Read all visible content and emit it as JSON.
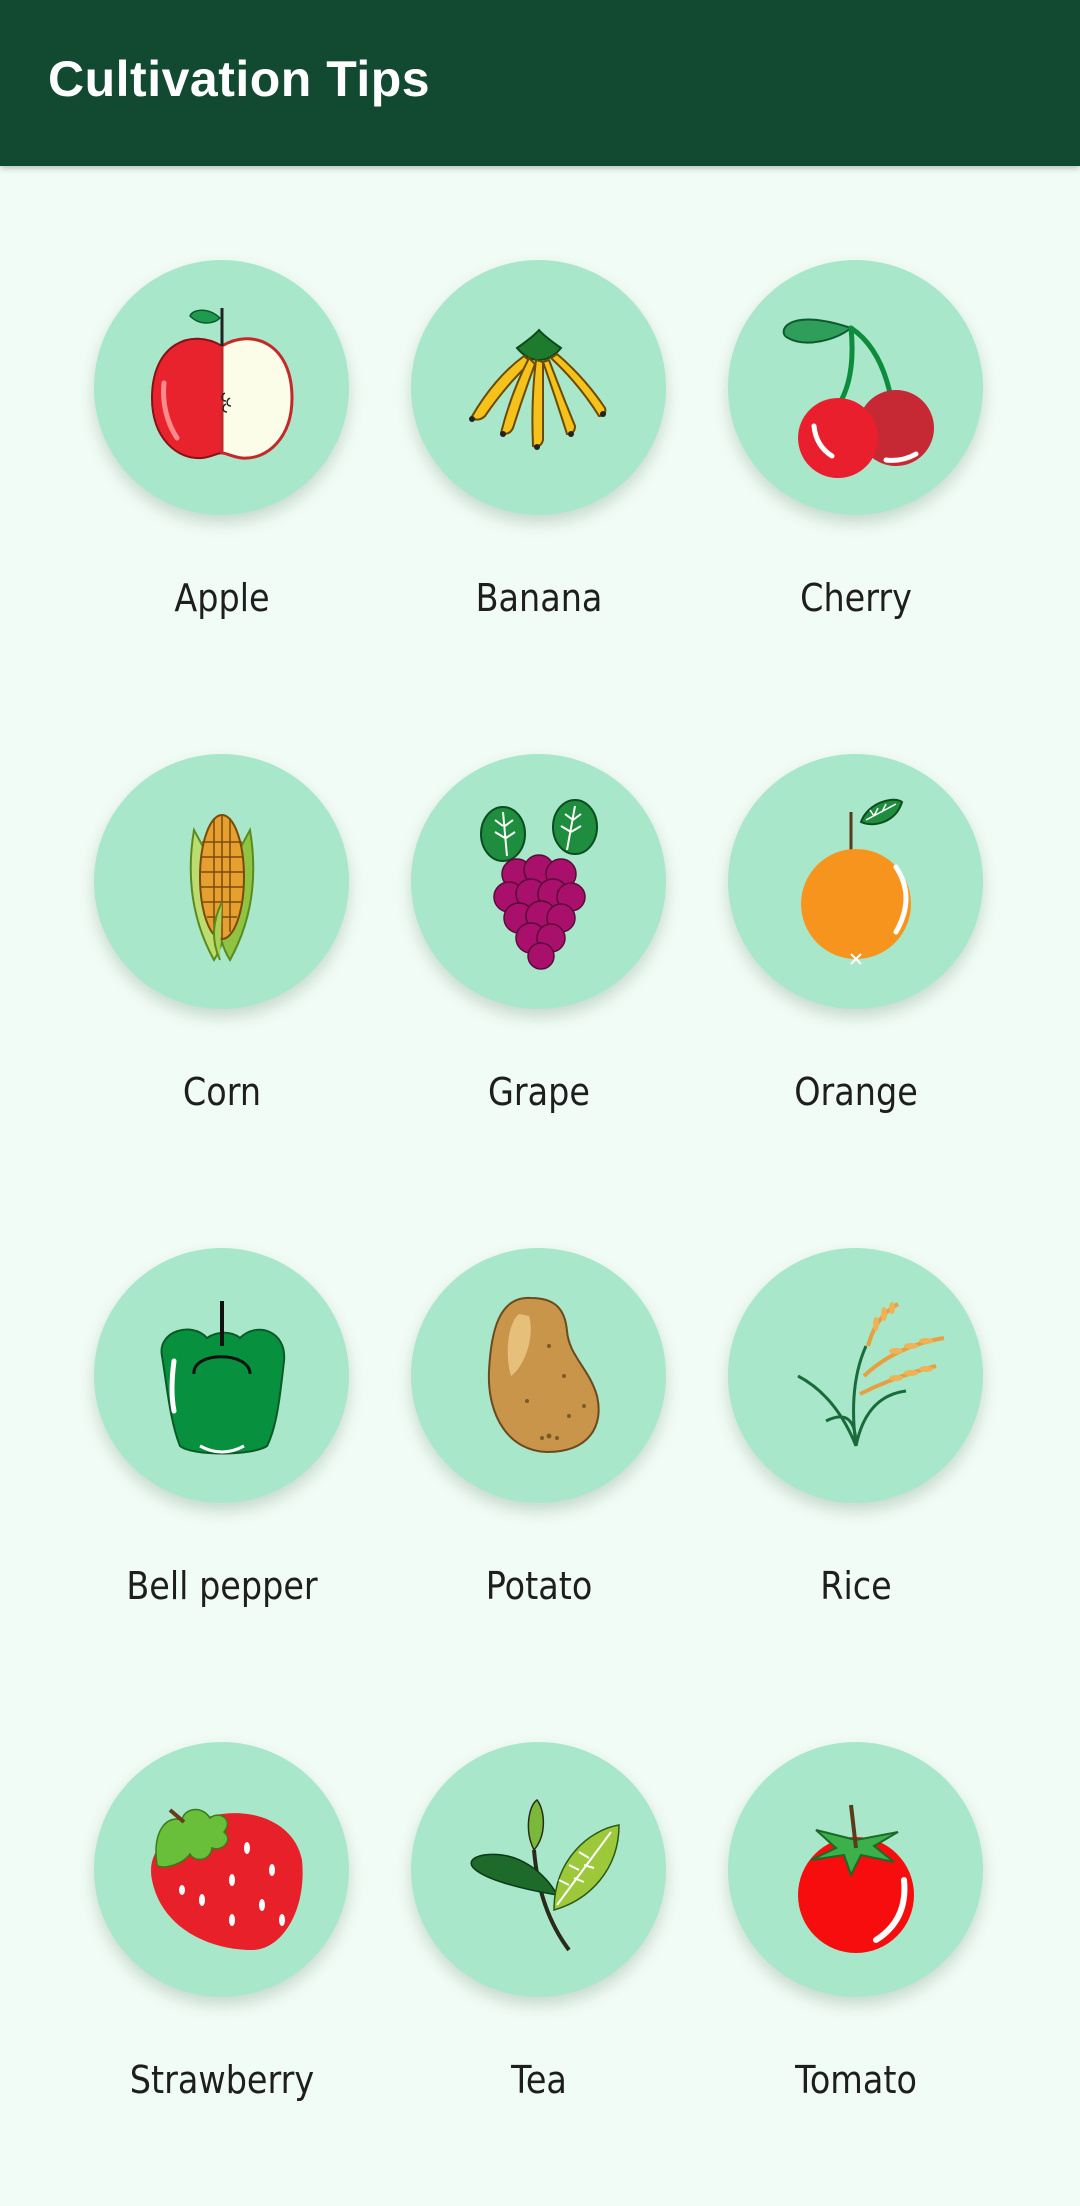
{
  "app_bar": {
    "title": "Cultivation Tips",
    "background": "#114a30"
  },
  "grid": {
    "circle_color": "#a8e7ca",
    "items": [
      {
        "label": "Apple",
        "icon": "apple-icon"
      },
      {
        "label": "Banana",
        "icon": "banana-icon"
      },
      {
        "label": "Cherry",
        "icon": "cherry-icon"
      },
      {
        "label": "Corn",
        "icon": "corn-icon"
      },
      {
        "label": "Grape",
        "icon": "grape-icon"
      },
      {
        "label": "Orange",
        "icon": "orange-icon"
      },
      {
        "label": "Bell pepper",
        "icon": "bell-pepper-icon"
      },
      {
        "label": "Potato",
        "icon": "potato-icon"
      },
      {
        "label": "Rice",
        "icon": "rice-icon"
      },
      {
        "label": "Strawberry",
        "icon": "strawberry-icon"
      },
      {
        "label": "Tea",
        "icon": "tea-icon"
      },
      {
        "label": "Tomato",
        "icon": "tomato-icon"
      }
    ]
  }
}
